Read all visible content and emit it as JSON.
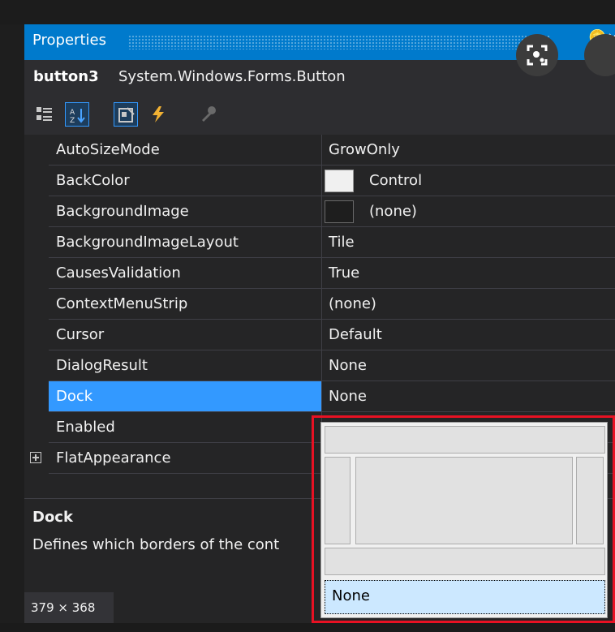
{
  "panel": {
    "title": "Properties",
    "object_name": "button3",
    "object_type": "System.Windows.Forms.Button"
  },
  "toolbar": {
    "buttons": [
      {
        "icon": "categorized-icon",
        "selected": false
      },
      {
        "icon": "alphabetical-sort-icon",
        "selected": true
      },
      {
        "icon": "properties-icon",
        "selected": true
      },
      {
        "icon": "events-lightning-icon",
        "selected": false
      },
      {
        "icon": "property-pages-wrench-icon",
        "selected": false
      }
    ]
  },
  "properties": [
    {
      "name": "AutoSizeMode",
      "value": "GrowOnly"
    },
    {
      "name": "BackColor",
      "value": "Control",
      "swatch": "#f0f0f0"
    },
    {
      "name": "BackgroundImage",
      "value": "(none)",
      "swatch": "#1e1e1e"
    },
    {
      "name": "BackgroundImageLayout",
      "value": "Tile"
    },
    {
      "name": "CausesValidation",
      "value": "True"
    },
    {
      "name": "ContextMenuStrip",
      "value": "(none)"
    },
    {
      "name": "Cursor",
      "value": "Default"
    },
    {
      "name": "DialogResult",
      "value": "None"
    },
    {
      "name": "Dock",
      "value": "None",
      "selected": true
    },
    {
      "name": "Enabled",
      "value": ""
    },
    {
      "name": "FlatAppearance",
      "value": "",
      "expandable": true
    }
  ],
  "description": {
    "title": "Dock",
    "text": "Defines which borders of the cont"
  },
  "size_badge": "379 × 368",
  "dock_dropdown": {
    "option_none": "None"
  },
  "colors": {
    "accent": "#007acc",
    "selection": "#3399ff",
    "annotation": "#e81123"
  }
}
